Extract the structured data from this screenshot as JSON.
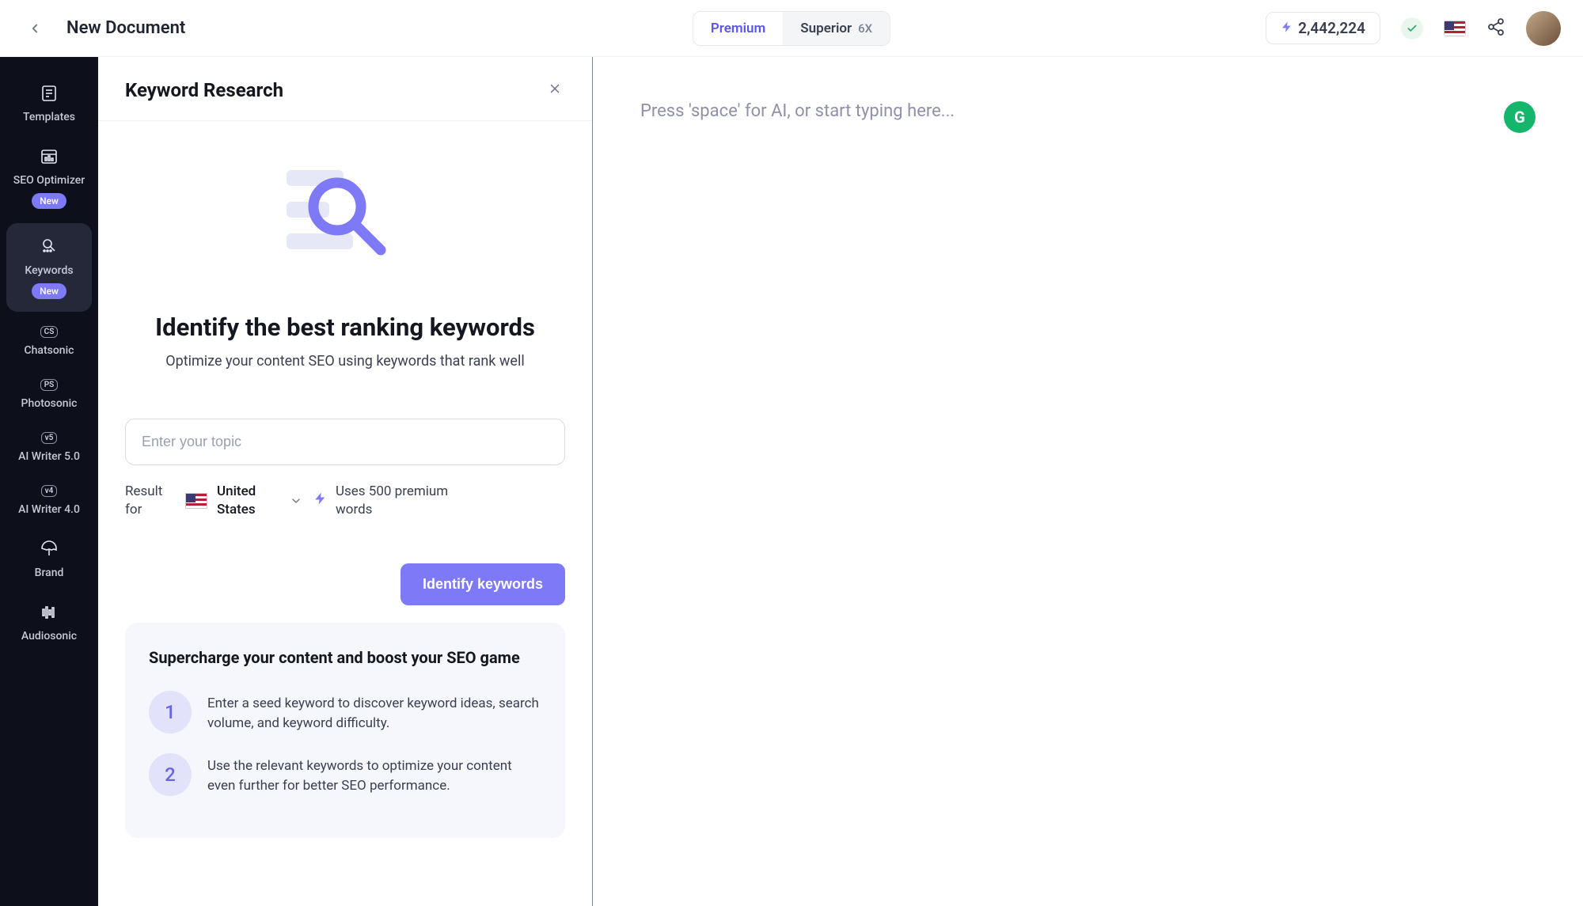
{
  "header": {
    "doc_title": "New Document",
    "toggle": {
      "premium": "Premium",
      "superior": "Superior",
      "superior_mult": "6X"
    },
    "credits": "2,442,224"
  },
  "sidebar": {
    "items": [
      {
        "label": "Templates"
      },
      {
        "label": "SEO Optimizer",
        "badge": "New"
      },
      {
        "label": "Keywords",
        "badge": "New"
      },
      {
        "label": "Chatsonic",
        "pill": "CS"
      },
      {
        "label": "Photosonic",
        "pill": "PS"
      },
      {
        "label": "AI Writer 5.0",
        "pill": "v5"
      },
      {
        "label": "AI Writer 4.0",
        "pill": "v4"
      },
      {
        "label": "Brand"
      },
      {
        "label": "Audiosonic"
      }
    ]
  },
  "panel": {
    "title": "Keyword Research",
    "headline": "Identify the best ranking keywords",
    "subtitle": "Optimize your content SEO using keywords that rank well",
    "input_placeholder": "Enter your topic",
    "result_label": "Result for",
    "country": "United States",
    "uses_words": "Uses 500 premium words",
    "cta": "Identify keywords",
    "info_heading": "Supercharge your content and boost your SEO game",
    "steps": [
      {
        "num": "1",
        "text": "Enter a seed keyword to discover keyword ideas, search volume, and keyword difficulty."
      },
      {
        "num": "2",
        "text": "Use the relevant keywords to optimize your content even further for better SEO performance."
      }
    ]
  },
  "editor": {
    "placeholder": "Press 'space' for AI, or start typing here...",
    "grammarly_letter": "G"
  }
}
